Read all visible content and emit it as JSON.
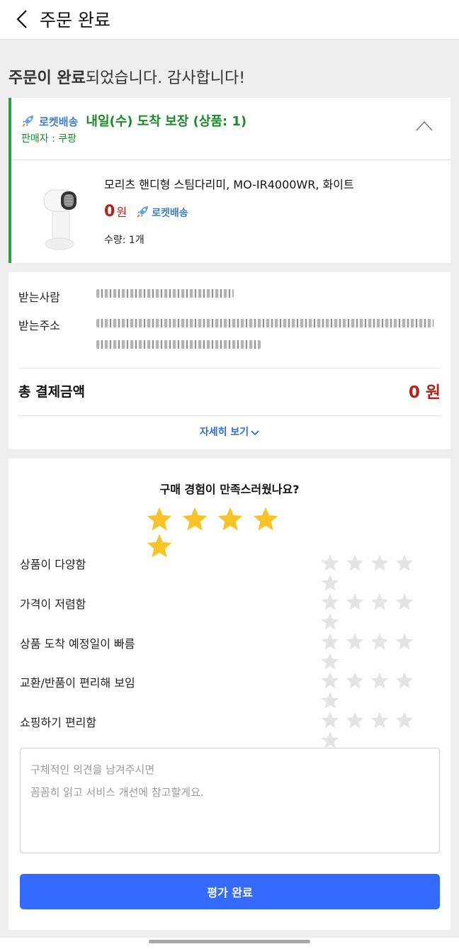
{
  "header": {
    "title": "주문 완료",
    "back_icon": "chevron-left-icon"
  },
  "headline": {
    "bold": "주문이 완료",
    "rest": "되었습니다. 감사합니다!"
  },
  "delivery": {
    "badge": "로켓배송",
    "guarantee": "내일(수) 도착 보장 (상품: 1)",
    "seller": "판매자 : 쿠팡",
    "collapse_icon": "chevron-up-icon"
  },
  "product": {
    "name": "모리츠 핸디형 스팀다리미, MO-IR4000WR, 화이트",
    "price": "0",
    "currency": "원",
    "badge": "로켓배송",
    "quantity": "수량: 1개"
  },
  "recipient": {
    "name_label": "받는사람",
    "address_label": "받는주소",
    "total_label": "총 결제금액",
    "total_value": "0 원",
    "detail_link": "자세히 보기"
  },
  "survey": {
    "question": "구매 경험이 만족스러웠나요?",
    "overall_rating": 5,
    "criteria": [
      "상품이 다양함",
      "가격이 저렴함",
      "상품 도착 예정일이 빠름",
      "교환/반품이 편리해 보임",
      "쇼핑하기 편리함"
    ],
    "placeholder": "구체적인 의견을 남겨주시면\n꼼꼼히 읽고 서비스 개선에 참고할게요.",
    "submit": "평가 완료"
  },
  "colors": {
    "accent_blue": "#346aff",
    "price_red": "#b1241d",
    "rocket_green": "#1c8a2b",
    "star_gold": "#f7c325"
  }
}
